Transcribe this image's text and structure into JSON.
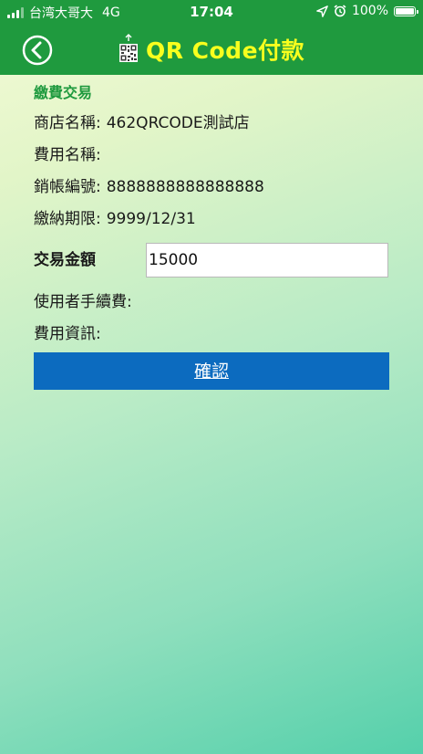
{
  "status_bar": {
    "carrier": "台湾大哥大",
    "network": "4G",
    "time": "17:04",
    "battery": "100%",
    "battery_level": 1.0
  },
  "nav": {
    "title": "QR Code付款",
    "back_icon": "back-arrow-icon",
    "title_icon": "qr-code-icon",
    "background_color": "#1f9a3e",
    "title_color": "#f8ff1e"
  },
  "section_title": "繳費交易",
  "info": {
    "store_label": "商店名稱:",
    "store_value": "462QRCODE測試店",
    "fee_label": "費用名稱:",
    "fee_value": "",
    "account_label": "銷帳編號:",
    "account_value": "8888888888888888",
    "deadline_label": "繳納期限:",
    "deadline_value": "9999/12/31"
  },
  "amount": {
    "label": "交易金額",
    "value": "15000"
  },
  "extra": {
    "handling_fee_label": "使用者手續費:",
    "fee_info_label": "費用資訊:"
  },
  "confirm_label": "確認",
  "colors": {
    "accent_green": "#1f9a3e",
    "button_blue": "#0c6bbf"
  }
}
